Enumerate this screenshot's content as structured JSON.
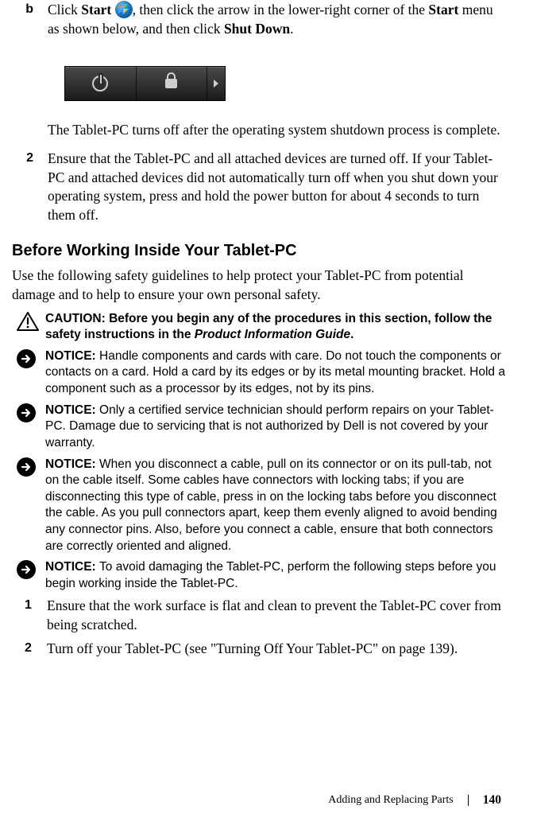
{
  "step_b": {
    "bullet": "b",
    "pre": "Click ",
    "start": "Start",
    "mid1": " ",
    "mid2": ", then click the arrow in the lower-right corner of the ",
    "start2": "Start",
    "mid3": " menu as shown below, and then click ",
    "shut": "Shut Down",
    "tail": "."
  },
  "result_para": "The Tablet-PC turns off after the operating system shutdown process is complete.",
  "step_2": {
    "bullet": "2",
    "text": "Ensure that the Tablet-PC and all attached devices are turned off. If your Tablet-PC and attached devices did not automatically turn off when you shut down your operating system, press and hold the power button for about 4 seconds to turn them off."
  },
  "subhead": "Before Working Inside Your Tablet-PC",
  "intro": "Use the following safety guidelines to help protect your Tablet-PC from potential damage and to help to ensure your own personal safety.",
  "caution": {
    "label": "CAUTION: ",
    "pre": "Before you begin any of the procedures in this section, follow the safety instructions in the ",
    "guide": "Product Information Guide",
    "tail": "."
  },
  "notice1": {
    "label": "NOTICE: ",
    "text": "Handle components and cards with care. Do not touch the components or contacts on a card. Hold a card by its edges or by its metal mounting bracket. Hold a component such as a processor by its edges, not by its pins."
  },
  "notice2": {
    "label": "NOTICE: ",
    "text": "Only a certified service technician should perform repairs on your Tablet-PC. Damage due to servicing that is not authorized by Dell is not covered by your warranty."
  },
  "notice3": {
    "label": "NOTICE: ",
    "text": "When you disconnect a cable, pull on its connector or on its pull-tab, not on the cable itself. Some cables have connectors with locking tabs; if you are disconnecting this type of cable, press in on the locking tabs before you disconnect the cable. As you pull connectors apart, keep them evenly aligned to avoid bending any connector pins. Also, before you connect a cable, ensure that both connectors are correctly oriented and aligned."
  },
  "notice4": {
    "label": "NOTICE: ",
    "text": "To avoid damaging the Tablet-PC, perform the following steps before you begin working inside the Tablet-PC."
  },
  "s1": {
    "n": "1",
    "t": "Ensure that the work surface is flat and clean to prevent the Tablet-PC cover from being scratched."
  },
  "s2": {
    "n": "2",
    "t": "Turn off your Tablet-PC (see \"Turning Off Your Tablet-PC\" on page 139)."
  },
  "footer": {
    "chapter": "Adding and Replacing Parts",
    "page": "140"
  }
}
